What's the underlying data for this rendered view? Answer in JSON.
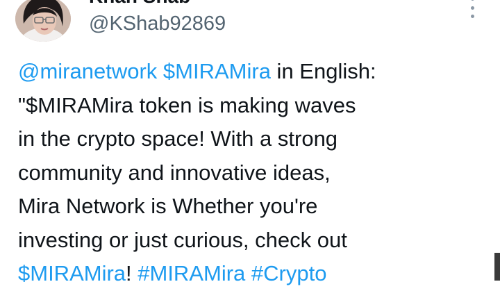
{
  "author": {
    "display_name": "Khan Shab",
    "handle": "@KShab92869"
  },
  "tweet": {
    "lines": [
      [
        {
          "text": "@miranetwork",
          "link": true
        },
        {
          "text": " ",
          "link": false
        },
        {
          "text": "$MIRAMira",
          "link": true
        },
        {
          "text": " in English:",
          "link": false
        }
      ],
      [
        {
          "text": "\"$MIRAMira token is making waves",
          "link": false
        }
      ],
      [
        {
          "text": "in the crypto space!  With a strong",
          "link": false
        }
      ],
      [
        {
          "text": "community and innovative ideas,",
          "link": false
        }
      ],
      [
        {
          "text": "Mira Network is  Whether you're",
          "link": false
        }
      ],
      [
        {
          "text": "investing or just curious, check out",
          "link": false
        }
      ],
      [
        {
          "text": "$MIRAMira",
          "link": true
        },
        {
          "text": "! ",
          "link": false
        },
        {
          "text": "#MIRAMira",
          "link": true
        },
        {
          "text": " ",
          "link": false
        },
        {
          "text": "#Crypto",
          "link": true
        }
      ]
    ]
  },
  "colors": {
    "link": "#1d9bf0",
    "text": "#0f1419",
    "secondary": "#536471"
  },
  "icons": {
    "more": "more-vertical-icon"
  }
}
